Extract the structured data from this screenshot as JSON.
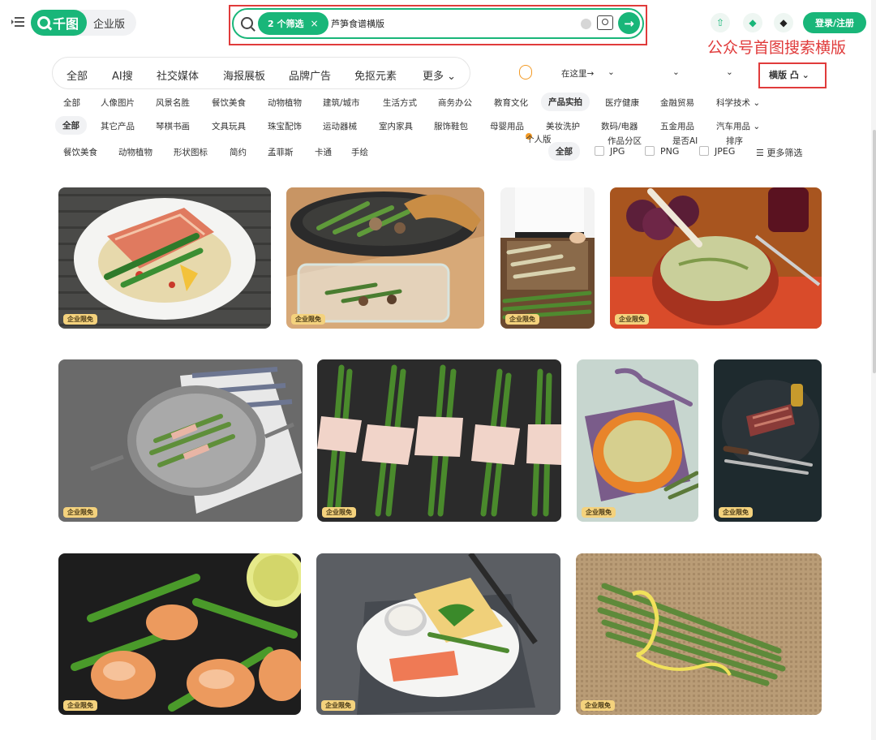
{
  "header": {
    "logo_text": "千图",
    "edition_label": "企业版",
    "search": {
      "filter_chip": "2 个筛选",
      "chip_close": "×",
      "query": "芦笋食谱横版",
      "go_symbol": "→"
    },
    "login_button": "登录/注册",
    "annotation": "公众号首图搜索横版"
  },
  "category_tabs": [
    "全部",
    "AI搜",
    "社交媒体",
    "海报展板",
    "品牌广告",
    "免抠元素",
    "更多"
  ],
  "right_controls": {
    "personal_badge": "个人版",
    "here_link": "在这里→",
    "section": "作品分区",
    "ai": "是否AI",
    "sort": "排序",
    "landscape": "横版"
  },
  "subject_row": [
    "全部",
    "人像图片",
    "风景名胜",
    "餐饮美食",
    "动物植物",
    "建筑/城市",
    "生活方式",
    "商务办公",
    "教育文化",
    "产品实拍",
    "医疗健康",
    "金融贸易",
    "科学技术"
  ],
  "subject_active": "产品实拍",
  "product_row": [
    "全部",
    "其它产品",
    "琴棋书画",
    "文具玩具",
    "珠宝配饰",
    "运动器械",
    "室内家具",
    "服饰鞋包",
    "母婴用品",
    "美妆洗护",
    "数码/电器",
    "五金用品",
    "汽车用品"
  ],
  "product_active": "全部",
  "style_row": [
    "餐饮美食",
    "动物植物",
    "形状图标",
    "简约",
    "孟菲斯",
    "卡通",
    "手绘"
  ],
  "format": {
    "all": "全部",
    "jpg": "JPG",
    "png": "PNG",
    "jpeg": "JPEG",
    "more": "更多筛选"
  },
  "image_badge": "企业限免",
  "colors": {
    "brand": "#19b679",
    "highlight": "#e03b3b",
    "personal": "#f39a25"
  }
}
